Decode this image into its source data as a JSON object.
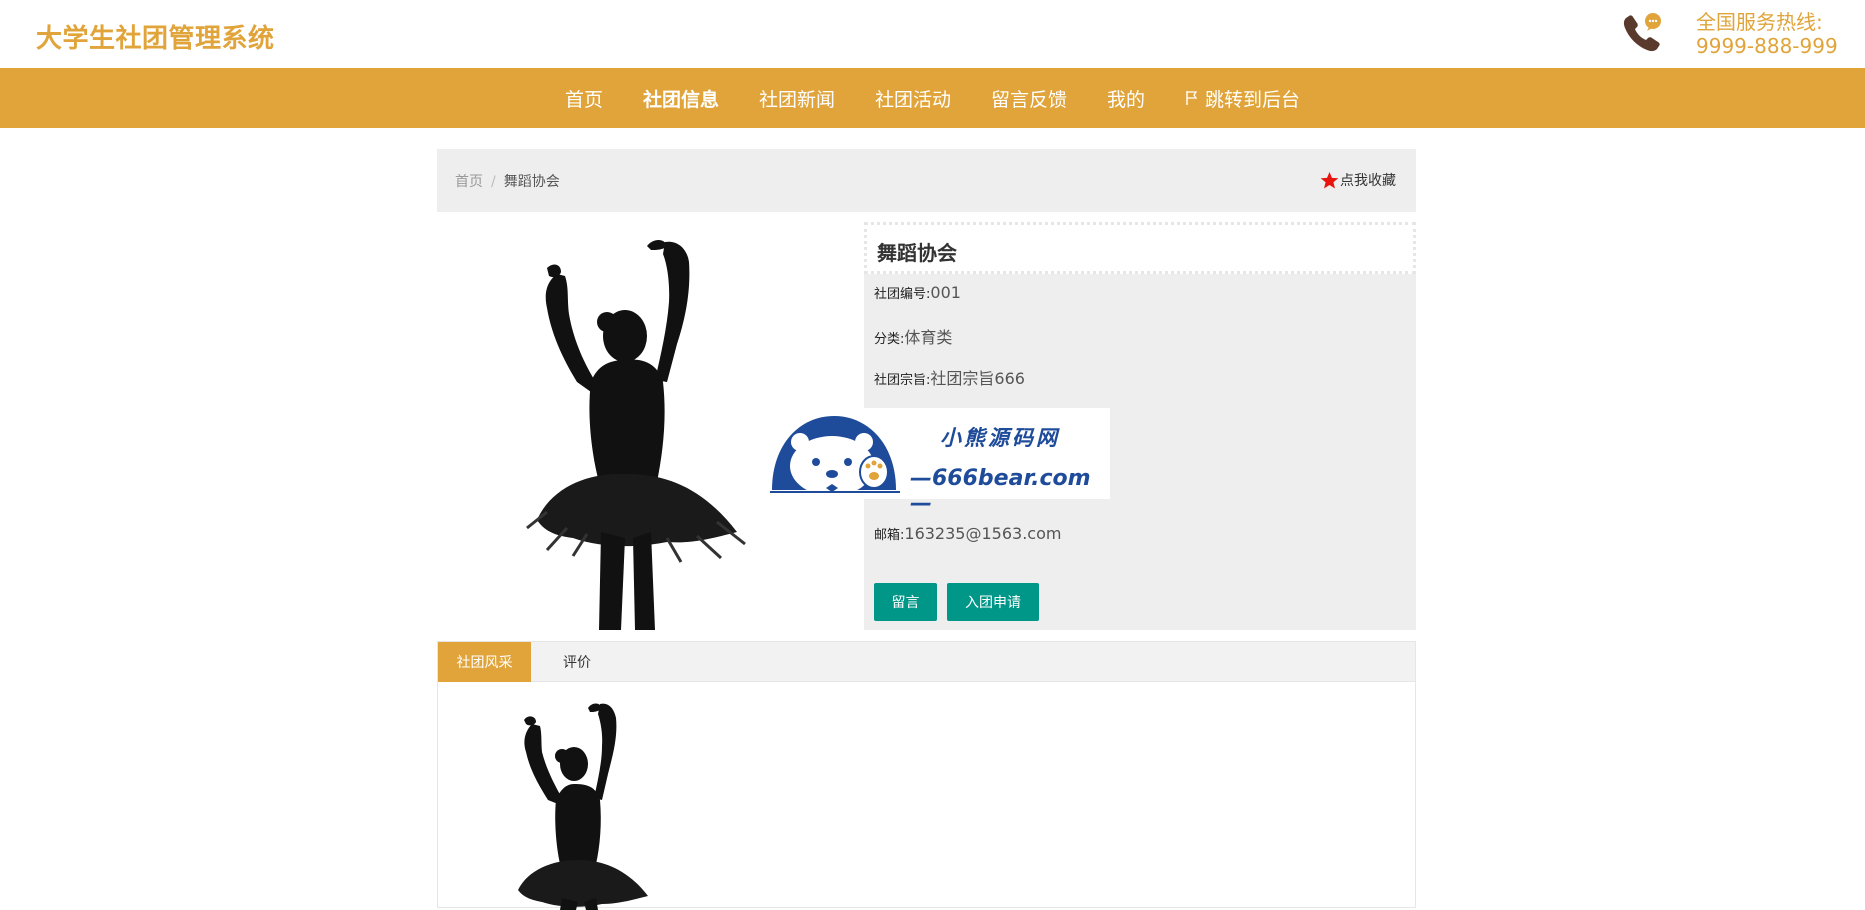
{
  "header": {
    "site_title": "大学生社团管理系统",
    "hotline_label": "全国服务热线:",
    "hotline_number": "9999-888-999",
    "hotline_icon": "phone-chat-icon",
    "accent_color": "#e0a43a"
  },
  "nav": {
    "items": [
      {
        "label": "首页"
      },
      {
        "label": "社团信息"
      },
      {
        "label": "社团新闻"
      },
      {
        "label": "社团活动"
      },
      {
        "label": "留言反馈"
      },
      {
        "label": "我的"
      },
      {
        "label": "跳转到后台"
      }
    ],
    "active": "社团信息"
  },
  "breadcrumb": {
    "home": "首页",
    "separator": "/",
    "current": "舞蹈协会"
  },
  "favorite": {
    "label": "点我收藏",
    "icon": "star-icon",
    "icon_color": "#e8150f"
  },
  "club": {
    "name": "舞蹈协会",
    "fields": [
      {
        "label": "社团编号:",
        "value": "001"
      },
      {
        "label": "分类:",
        "value": "体育类"
      },
      {
        "label": "社团宗旨:",
        "value": "社团宗旨666"
      },
      {
        "label": "邮箱:",
        "value": "163235@1563.com"
      }
    ],
    "image": "ballet-dancer-silhouette"
  },
  "actions": {
    "message_label": "留言",
    "apply_label": "入团申请",
    "button_color": "#009688"
  },
  "watermark": {
    "text_cn": "小熊源码网",
    "text_en": "—666bear.com—",
    "icon": "bear-logo-icon"
  },
  "tabs": {
    "items": [
      {
        "label": "社团风采"
      },
      {
        "label": "评价"
      }
    ],
    "active": "社团风采"
  }
}
